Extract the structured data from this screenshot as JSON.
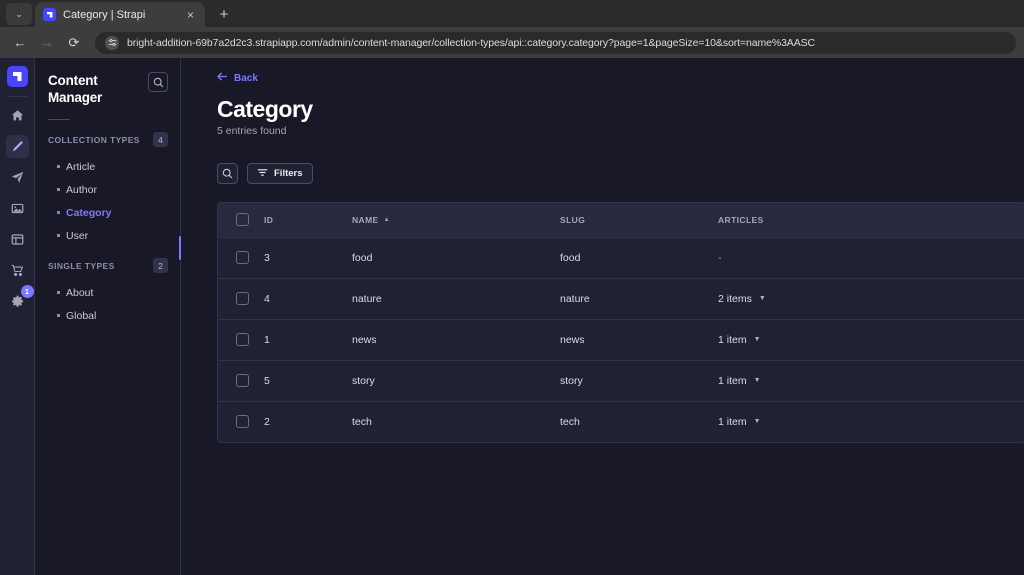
{
  "browser": {
    "tab": {
      "title": "Category | Strapi",
      "favicon": "strapi-logo-icon",
      "close_label": "×"
    },
    "new_tab_label": "+",
    "tab_list_chevron": "⌄",
    "nav": {
      "back": "←",
      "forward": "→",
      "reload": "⟳"
    },
    "url": "bright-addition-69b7a2d2c3.strapiapp.com/admin/content-manager/collection-types/api::category.category?page=1&pageSize=10&sort=name%3AASC",
    "site_settings_icon": "tune-icon"
  },
  "rail": {
    "logo": "strapi-logo-icon",
    "items": [
      {
        "name": "home-icon",
        "active": false
      },
      {
        "name": "content-manager-pen-icon",
        "active": true
      },
      {
        "name": "plugins-send-icon",
        "active": false
      },
      {
        "name": "media-library-icon",
        "active": false
      },
      {
        "name": "content-type-builder-icon",
        "active": false
      },
      {
        "name": "marketplace-cart-icon",
        "active": false
      },
      {
        "name": "settings-gear-icon",
        "active": false,
        "badge": "1"
      }
    ]
  },
  "sidebar": {
    "title": "Content Manager",
    "search_icon": "search-icon",
    "groups": [
      {
        "label": "COLLECTION TYPES",
        "badge": "4",
        "items": [
          {
            "label": "Article",
            "active": false
          },
          {
            "label": "Author",
            "active": false
          },
          {
            "label": "Category",
            "active": true
          },
          {
            "label": "User",
            "active": false
          }
        ]
      },
      {
        "label": "SINGLE TYPES",
        "badge": "2",
        "items": [
          {
            "label": "About",
            "active": false
          },
          {
            "label": "Global",
            "active": false
          }
        ]
      }
    ]
  },
  "main": {
    "back_label": "Back",
    "back_icon": "arrow-left-icon",
    "title": "Category",
    "entries_found": "5 entries found",
    "toolbar": {
      "search_icon": "search-icon",
      "filters_label": "Filters",
      "filters_icon": "filter-icon"
    },
    "table": {
      "columns": [
        {
          "key": "check",
          "label": ""
        },
        {
          "key": "id",
          "label": "ID"
        },
        {
          "key": "name",
          "label": "NAME",
          "sorted": "asc",
          "sort_icon": "▲"
        },
        {
          "key": "slug",
          "label": "SLUG"
        },
        {
          "key": "articles",
          "label": "ARTICLES"
        }
      ],
      "rows": [
        {
          "id": "3",
          "name": "food",
          "slug": "food",
          "articles": "-",
          "articles_has_chevron": false
        },
        {
          "id": "4",
          "name": "nature",
          "slug": "nature",
          "articles": "2 items",
          "articles_has_chevron": true
        },
        {
          "id": "1",
          "name": "news",
          "slug": "news",
          "articles": "1 item",
          "articles_has_chevron": true
        },
        {
          "id": "5",
          "name": "story",
          "slug": "story",
          "articles": "1 item",
          "articles_has_chevron": true
        },
        {
          "id": "2",
          "name": "tech",
          "slug": "tech",
          "articles": "1 item",
          "articles_has_chevron": true
        }
      ]
    }
  },
  "colors": {
    "accent": "#7b79ff",
    "brand": "#4945ff",
    "surface": "#212134",
    "background": "#181826",
    "border": "#32324d"
  }
}
